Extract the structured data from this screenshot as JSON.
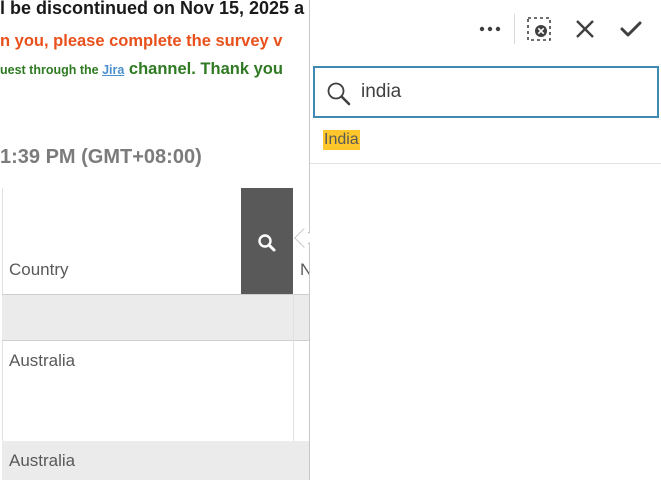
{
  "notice": {
    "line1": "l be discontinued on Nov 15, 2025 a",
    "line2": "n you, please complete the survey v",
    "line3_small": "uest through the ",
    "line3_link": "Jira",
    "line3_big": " channel. Thank you"
  },
  "timestamp": "1:39 PM (GMT+08:00)",
  "table": {
    "column_header": "Country",
    "next_column_header_partial": "N",
    "rows": [
      "Australia",
      "Australia"
    ]
  },
  "icons": {
    "column_search": "search-icon",
    "more": "ellipsis-icon",
    "clear_selection": "clear-selection-icon",
    "cancel": "close-icon",
    "confirm": "checkmark-icon",
    "search_field": "search-icon"
  },
  "listbox": {
    "search_value": "india",
    "results": [
      "India"
    ],
    "highlight_color": "#ffc72a",
    "search_border_color": "#3f8ab3"
  }
}
